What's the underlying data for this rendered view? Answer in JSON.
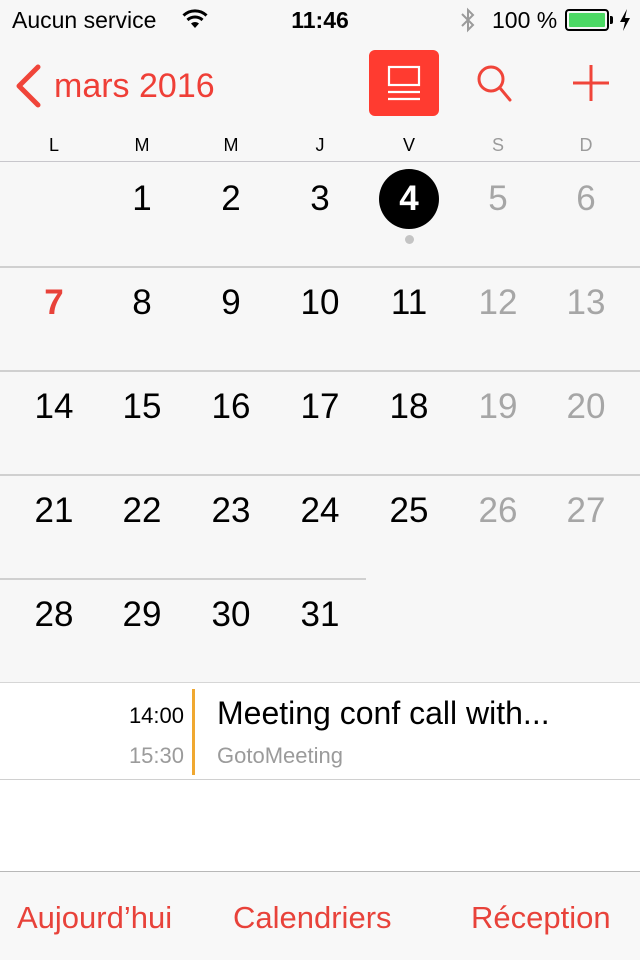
{
  "status_bar": {
    "carrier": "Aucun service",
    "time": "11:46",
    "battery_percent": "100 %",
    "battery_level": 1.0,
    "colors": {
      "battery_fill": "#4cd964"
    }
  },
  "nav": {
    "back_label": "mars 2016",
    "accent": "#ef3f37"
  },
  "weekdays": [
    {
      "label": "L",
      "weekend": false
    },
    {
      "label": "M",
      "weekend": false
    },
    {
      "label": "M",
      "weekend": false
    },
    {
      "label": "J",
      "weekend": false
    },
    {
      "label": "V",
      "weekend": false
    },
    {
      "label": "S",
      "weekend": true
    },
    {
      "label": "D",
      "weekend": true
    }
  ],
  "month": {
    "first_weekday_index": 1,
    "days_in_month": 31,
    "today": 4,
    "highlighted_red": 7,
    "days_with_events": [
      4
    ]
  },
  "events": [
    {
      "start": "14:00",
      "end": "15:30",
      "title": "Meeting conf call with...",
      "location": "GotoMeeting",
      "color": "#f0a830"
    }
  ],
  "tabbar": {
    "today": "Aujourd’hui",
    "calendars": "Calendriers",
    "inbox": "Réception"
  }
}
